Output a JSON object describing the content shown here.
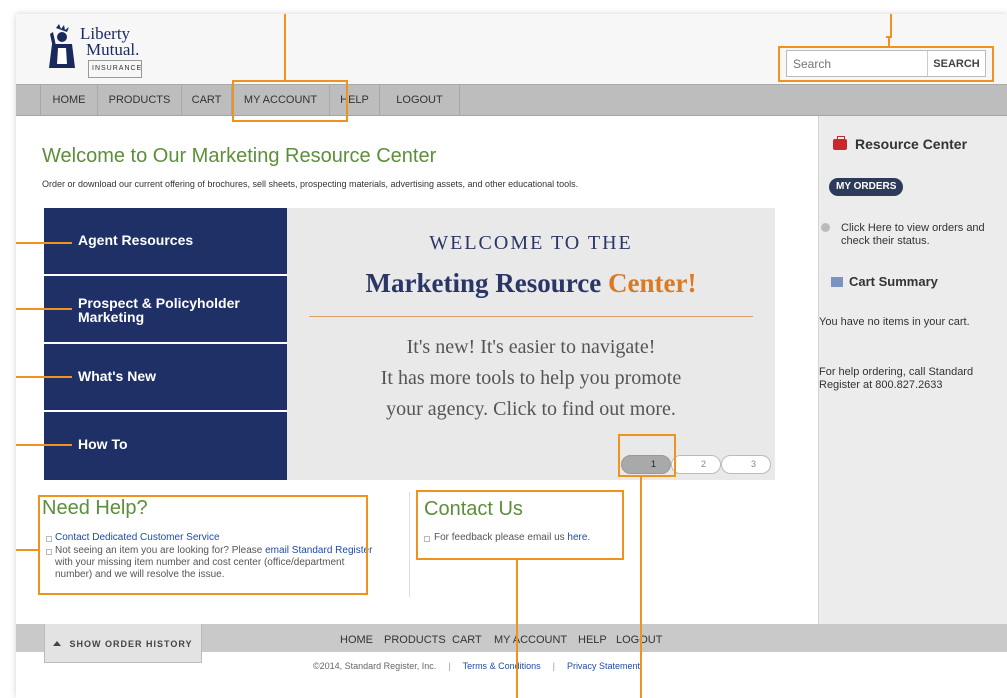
{
  "brand": {
    "line1": "Liberty",
    "line2": "Mutual.",
    "line3": "INSURANCE"
  },
  "search": {
    "placeholder": "Search",
    "button": "SEARCH"
  },
  "nav": [
    "HOME",
    "PRODUCTS",
    "CART",
    "MY ACCOUNT",
    "HELP",
    "LOGOUT"
  ],
  "main": {
    "title": "Welcome to Our Marketing Resource Center",
    "subtitle": "Order or download our current offering of brochures, sell sheets, prospecting materials, advertising assets, and other educational tools."
  },
  "tiles": [
    "Agent Resources",
    "Prospect & Policyholder Marketing",
    "What's New",
    "How To"
  ],
  "banner": {
    "line1": "WELCOME TO THE",
    "line2a": "Marketing Resource",
    "line2b": "Center!",
    "body1": "It's new! It's easier to navigate!",
    "body2": "It has more tools to help you promote",
    "body3": "your agency. Click to find out more."
  },
  "pager": [
    "1",
    "2",
    "3"
  ],
  "needhelp": {
    "title": "Need Help?",
    "item1": "Contact Dedicated Customer Service",
    "item2a": "Not seeing an item you are looking for? Please ",
    "item2link": "email Standard Register",
    "item2b": " with your missing item number and cost center (office/department number) and we will resolve the issue."
  },
  "contact": {
    "title": "Contact Us",
    "text": "For feedback please email us ",
    "link": "here",
    "end": "."
  },
  "sidebar": {
    "title": "Resource Center",
    "my_orders": "MY ORDERS",
    "orders_text": "Click Here to view orders and check their status.",
    "cart_title": "Cart Summary",
    "cart_empty": "You have no items in your cart.",
    "help_text": "For help ordering, call Standard Register at 800.827.2633"
  },
  "footer": {
    "order_history": "SHOW ORDER HISTORY",
    "nav": [
      "HOME",
      "PRODUCTS",
      "CART",
      "MY ACCOUNT",
      "HELP",
      "LOGOUT"
    ],
    "copyright": "©2014, Standard Register, Inc.",
    "sep": "|",
    "terms": "Terms & Conditions",
    "privacy": "Privacy Statement"
  },
  "colors": {
    "accent": "#f0931e",
    "navy": "#1f3066",
    "green": "#5c8f3a",
    "orange": "#d97a27"
  }
}
